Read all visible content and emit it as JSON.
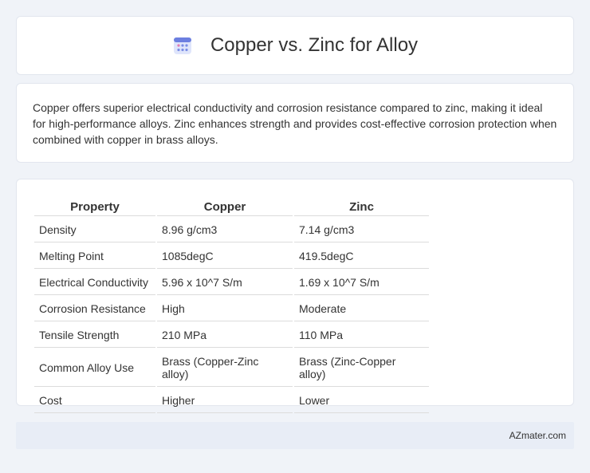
{
  "header": {
    "title": "Copper vs. Zinc for Alloy",
    "icon": "calendar-icon"
  },
  "description": "Copper offers superior electrical conductivity and corrosion resistance compared to zinc, making it ideal for high-performance alloys. Zinc enhances strength and provides cost-effective corrosion protection when combined with copper in brass alloys.",
  "table": {
    "headers": [
      "Property",
      "Copper",
      "Zinc"
    ],
    "rows": [
      [
        "Density",
        "8.96 g/cm3",
        "7.14 g/cm3"
      ],
      [
        "Melting Point",
        "1085degC",
        "419.5degC"
      ],
      [
        "Electrical Conductivity",
        "5.96 x 10^7 S/m",
        "1.69 x 10^7 S/m"
      ],
      [
        "Corrosion Resistance",
        "High",
        "Moderate"
      ],
      [
        "Tensile Strength",
        "210 MPa",
        "110 MPa"
      ],
      [
        "Common Alloy Use",
        "Brass (Copper-Zinc alloy)",
        "Brass (Zinc-Copper alloy)"
      ],
      [
        "Cost",
        "Higher",
        "Lower"
      ]
    ]
  },
  "footer": {
    "site": "AZmater.com"
  },
  "colors": {
    "background": "#f0f3f8",
    "footer_bg": "#e8edf6",
    "icon_accent": "#6c7fe0"
  }
}
